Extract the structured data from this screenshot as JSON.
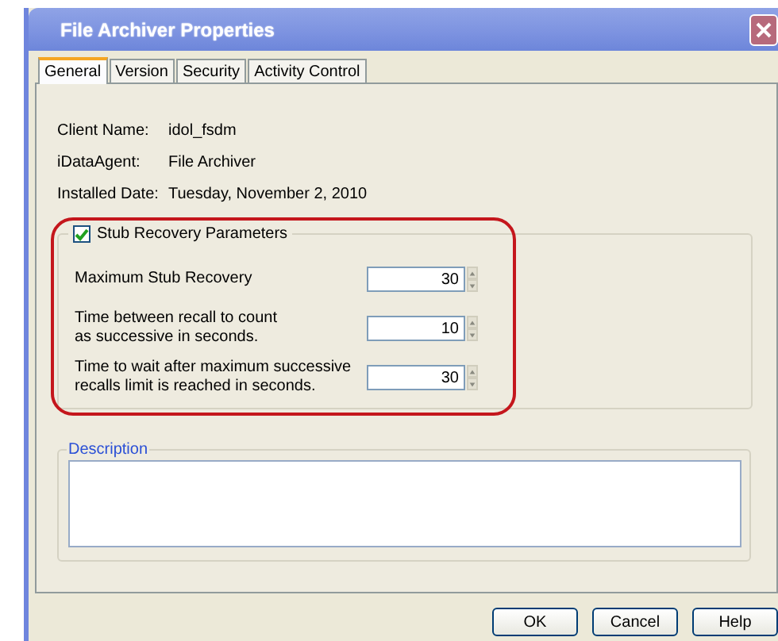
{
  "window": {
    "title": "File Archiver Properties"
  },
  "tabs": [
    {
      "label": "General",
      "selected": true
    },
    {
      "label": "Version",
      "selected": false
    },
    {
      "label": "Security",
      "selected": false
    },
    {
      "label": "Activity Control",
      "selected": false
    }
  ],
  "info": [
    {
      "label": "Client Name:",
      "value": "idol_fsdm"
    },
    {
      "label": "iDataAgent:",
      "value": "File Archiver"
    },
    {
      "label": "Installed Date:",
      "value": "Tuesday, November 2, 2010"
    }
  ],
  "stub_group": {
    "label": "Stub Recovery Parameters",
    "checked": true,
    "fields": [
      {
        "label": "Maximum Stub Recovery",
        "value": "30"
      },
      {
        "label": "Time between recall to count\nas successive in seconds.",
        "value": "10"
      },
      {
        "label": "Time to wait after maximum successive\nrecalls limit is reached in seconds.",
        "value": "30"
      }
    ]
  },
  "description": {
    "label": "Description"
  },
  "buttons": [
    "OK",
    "Cancel",
    "Help"
  ]
}
